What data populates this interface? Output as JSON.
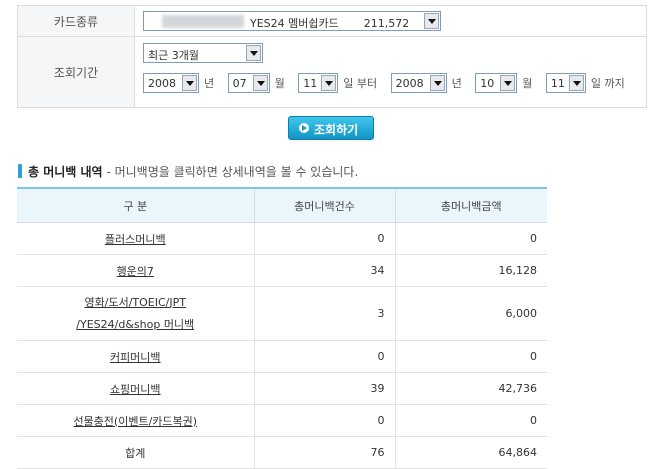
{
  "form": {
    "card_type_label": "카드종류",
    "card_value": "YES24 멤버쉽카드",
    "card_amount": "211,572",
    "period_label": "조회기간",
    "period_value": "최근 3개월",
    "from_year": "2008",
    "from_month": "07",
    "from_day": "11",
    "to_year": "2008",
    "to_month": "10",
    "to_day": "11",
    "unit_year": "년",
    "unit_month": "월",
    "unit_day_from": "일 부터",
    "unit_day_to": "일 까지"
  },
  "search_button": "조회하기",
  "section": {
    "title": "총 머니백 내역",
    "description": "- 머니백명을 클릭하면 상세내역을 볼 수 있습니다."
  },
  "table": {
    "headers": [
      "구 분",
      "총머니백건수",
      "총머니백금액"
    ],
    "rows": [
      {
        "name": "플러스머니백",
        "count": "0",
        "amount": "0"
      },
      {
        "name": "행운의7",
        "count": "34",
        "amount": "16,128"
      },
      {
        "name_line1": "영화/도서/TOEIC/JPT",
        "name_line2": "/YES24/d&shop 머니백",
        "count": "3",
        "amount": "6,000"
      },
      {
        "name": "커피머니백",
        "count": "0",
        "amount": "0"
      },
      {
        "name": "쇼핑머니백",
        "count": "39",
        "amount": "42,736"
      },
      {
        "name": "선물충전(이벤트/카드복권)",
        "count": "0",
        "amount": "0"
      }
    ],
    "total": {
      "name": "합계",
      "count": "76",
      "amount": "64,864"
    }
  },
  "colors": {
    "accent": "#2c9fd8",
    "button_top": "#3fc6ed",
    "button_bottom": "#1295c6",
    "header_bg": "#eaf6fc",
    "label_bg": "#f4f6f8"
  }
}
